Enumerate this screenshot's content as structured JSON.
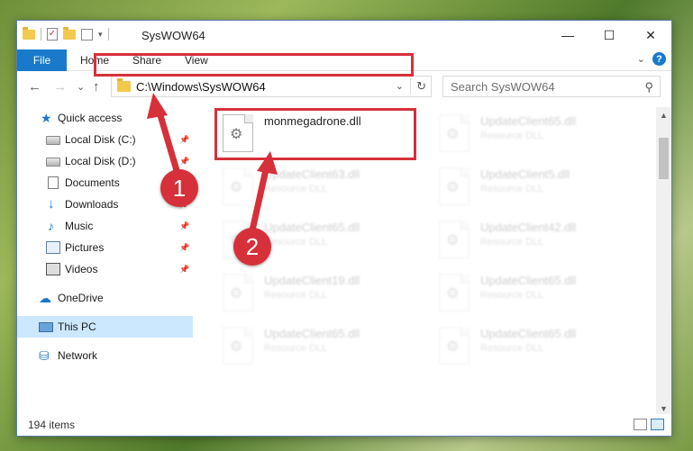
{
  "window": {
    "title": "SysWOW64",
    "min_glyph": "—",
    "max_glyph": "☐",
    "close_glyph": "✕"
  },
  "ribbon": {
    "tabs": [
      "File",
      "Home",
      "Share",
      "View"
    ],
    "help_glyph": "?",
    "expand_glyph": "⌄"
  },
  "quick_access_toolbar": {
    "check_glyph": "✓",
    "dropdown_glyph": "▾"
  },
  "navigation": {
    "back": "←",
    "forward": "→",
    "recent": "⌄",
    "up": "↑"
  },
  "address": {
    "path": "C:\\Windows\\SysWOW64",
    "dropdown_glyph": "⌄",
    "refresh_glyph": "↻"
  },
  "search": {
    "placeholder": "Search SysWOW64",
    "icon_glyph": "⚲"
  },
  "sidebar": {
    "items": [
      {
        "label": "Quick access",
        "icon": "star-icon",
        "glyph": "★",
        "pinned": false
      },
      {
        "label": "Local Disk (C:)",
        "icon": "drive-icon",
        "pinned": true
      },
      {
        "label": "Local Disk (D:)",
        "icon": "drive-icon",
        "pinned": true
      },
      {
        "label": "Documents",
        "icon": "document-icon",
        "pinned": true
      },
      {
        "label": "Downloads",
        "icon": "download-icon",
        "glyph": "↓",
        "pinned": true
      },
      {
        "label": "Music",
        "icon": "music-icon",
        "glyph": "♪",
        "pinned": true
      },
      {
        "label": "Pictures",
        "icon": "pictures-icon",
        "pinned": true
      },
      {
        "label": "Videos",
        "icon": "videos-icon",
        "pinned": true
      },
      {
        "label": "OneDrive",
        "icon": "cloud-icon",
        "glyph": "☁",
        "pinned": false
      },
      {
        "label": "This PC",
        "icon": "computer-icon",
        "pinned": false,
        "selected": true
      },
      {
        "label": "Network",
        "icon": "network-icon",
        "glyph": "⛁",
        "pinned": false
      }
    ],
    "pin_glyph": "📌"
  },
  "files": [
    {
      "name": "monmegadrone.dll",
      "type": "",
      "highlighted": true
    },
    {
      "name": "UpdateClient65.dll",
      "type": "Resource DLL"
    },
    {
      "name": "UpdateClient63.dll",
      "type": "Resource DLL"
    },
    {
      "name": "UpdateClient5.dll",
      "type": "Resource DLL"
    },
    {
      "name": "UpdateClient65.dll",
      "type": "Resource DLL"
    },
    {
      "name": "UpdateClient42.dll",
      "type": "Resource DLL"
    },
    {
      "name": "UpdateClient19.dll",
      "type": "Resource DLL"
    },
    {
      "name": "UpdateClient65.dll",
      "type": "Resource DLL"
    },
    {
      "name": "UpdateClient65.dll",
      "type": "Resource DLL"
    },
    {
      "name": "UpdateClient65.dll",
      "type": "Resource DLL"
    }
  ],
  "gear_glyph": "⚙",
  "scrollbar": {
    "up": "▲",
    "down": "▼"
  },
  "status": {
    "item_count": "194 items"
  },
  "callouts": [
    "1",
    "2"
  ],
  "colors": {
    "accent": "#1979ca",
    "annotation_red": "#d6303a",
    "selection": "#cce8ff"
  }
}
